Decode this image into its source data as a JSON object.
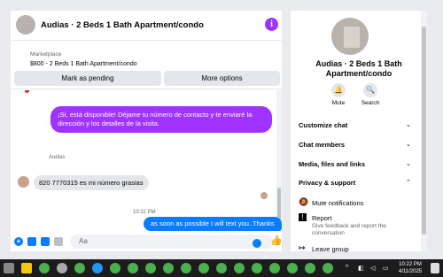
{
  "header": {
    "title": "Audias · 2 Beds 1 Bath Apartment/condo",
    "info_icon": "i"
  },
  "marketplace": {
    "label": "Marketplace",
    "listing": "$800 - 2 Beds 1 Bath Apartment/condo",
    "pending_label": "Mark as pending",
    "more_label": "More options"
  },
  "messages": {
    "out1": "¡Sí, está disponible! Déjame tu número de contacto y te enviaré la dirección y los detalles de la visita.",
    "sender": "Audias",
    "in1": "820 7770315 es mi número grasias",
    "time": "10:22 PM",
    "out2": "as soon as possible I will text you..Thanks"
  },
  "composer": {
    "placeholder": "Aa"
  },
  "side": {
    "name": "Audias · 2 Beds 1 Bath Apartment/condo",
    "mute_label": "Mute",
    "search_label": "Search",
    "sections": [
      "Customize chat",
      "Chat members",
      "Media, files and links",
      "Privacy & support"
    ],
    "mute_notifications": "Mute notifications",
    "report": "Report",
    "report_sub": "Give feedback and report the conversation",
    "leave": "Leave group"
  },
  "taskbar": {
    "time": "10:22 PM",
    "date": "4/11/2025"
  },
  "colors": {
    "accent": "#a033ff",
    "messenger_blue": "#0a7cff",
    "taskbar": "#1c1c1c"
  }
}
